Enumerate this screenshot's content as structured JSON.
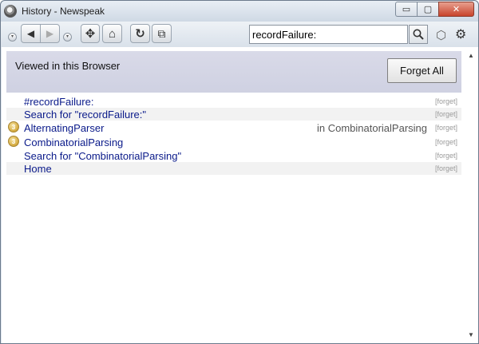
{
  "window": {
    "title": "History - Newspeak",
    "minimize_label": "▭",
    "maximize_label": "▢",
    "close_label": "✕"
  },
  "toolbar": {
    "back_label": "◀",
    "forward_label": "▶",
    "navigate_icon": "✥",
    "home_icon": "⌂",
    "refresh_icon": "↻",
    "new_window_icon": "⧉",
    "search_value": "recordFailure:",
    "settings_icon": "⚙",
    "workspace_icon": "⬡"
  },
  "header": {
    "title": "Viewed in this Browser",
    "forget_all_label": "Forget All"
  },
  "history": [
    {
      "label": "#recordFailure:",
      "context": "",
      "forget": "[forget]",
      "badge": "",
      "shaded": false
    },
    {
      "label": "Search for \"recordFailure:\"",
      "context": "",
      "forget": "[forget]",
      "badge": "",
      "shaded": true
    },
    {
      "label": "AlternatingParser",
      "context": "in CombinatorialParsing",
      "forget": "[forget]",
      "badge": "3",
      "shaded": false
    },
    {
      "label": "CombinatorialParsing",
      "context": "",
      "forget": "[forget]",
      "badge": "3",
      "shaded": false
    },
    {
      "label": "Search for \"CombinatorialParsing\"",
      "context": "",
      "forget": "[forget]",
      "badge": "",
      "shaded": false
    },
    {
      "label": "Home",
      "context": "",
      "forget": "[forget]",
      "badge": "",
      "shaded": true
    }
  ],
  "colors": {
    "link": "#0a1a8a",
    "header_band": "#d3d5e5",
    "badge": "#d4aa40"
  }
}
